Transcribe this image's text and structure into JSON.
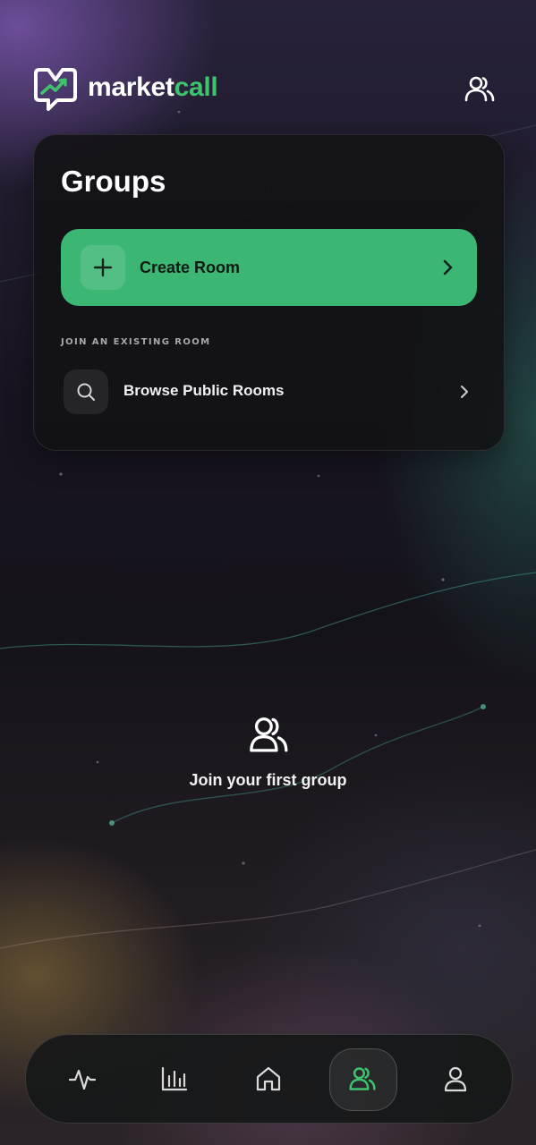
{
  "app": {
    "brand_part1": "market",
    "brand_part2": "call",
    "accent_color": "#3ec46d"
  },
  "header": {
    "groups_icon": "users-icon"
  },
  "groups_card": {
    "title": "Groups",
    "create_room": {
      "label": "Create Room",
      "icon": "plus-icon",
      "chevron": "chevron-right-icon",
      "color": "#3bb673"
    },
    "section_label": "JOIN AN EXISTING ROOM",
    "browse": {
      "label": "Browse Public Rooms",
      "icon": "search-icon",
      "chevron": "chevron-right-icon"
    }
  },
  "empty_state": {
    "icon": "users-icon",
    "text": "Join your first group"
  },
  "bottom_nav": {
    "items": [
      {
        "name": "activity",
        "icon": "pulse-icon",
        "active": false
      },
      {
        "name": "charts",
        "icon": "bar-chart-icon",
        "active": false
      },
      {
        "name": "home",
        "icon": "home-icon",
        "active": false
      },
      {
        "name": "groups",
        "icon": "users-icon",
        "active": true
      },
      {
        "name": "profile",
        "icon": "user-icon",
        "active": false
      }
    ],
    "active_color": "#3ec46d"
  }
}
